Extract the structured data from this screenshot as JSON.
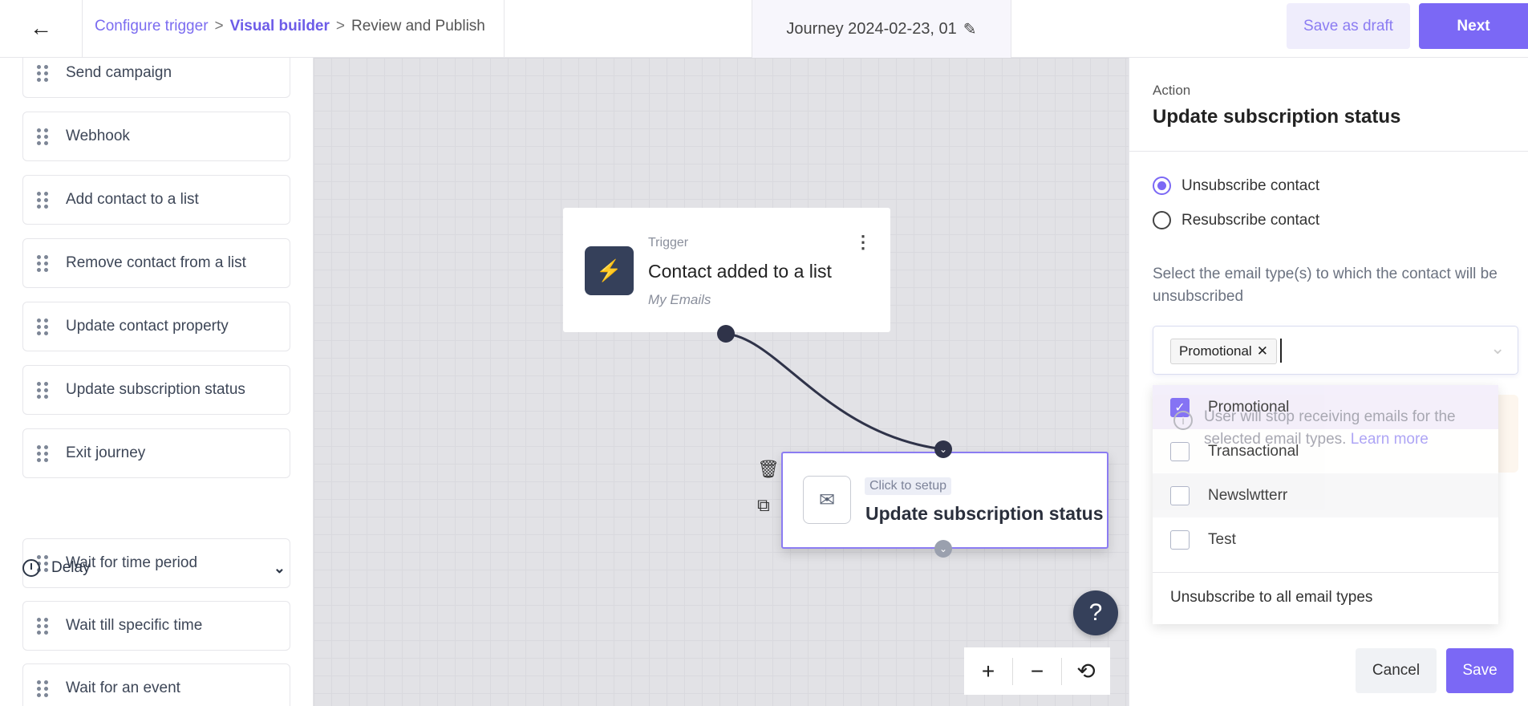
{
  "header": {
    "breadcrumbs": [
      "Configure trigger",
      "Visual builder",
      "Review and Publish"
    ],
    "breadcrumb_separator": ">",
    "journey_title": "Journey 2024-02-23, 01",
    "save_draft_label": "Save as draft",
    "next_label": "Next"
  },
  "sidebar": {
    "items": [
      "Send campaign",
      "Webhook",
      "Add contact to a list",
      "Remove contact from a list",
      "Update contact property",
      "Update subscription status",
      "Exit journey"
    ],
    "delay_section": "Delay",
    "delay_items": [
      "Wait for time period",
      "Wait till specific time",
      "Wait for an event"
    ]
  },
  "canvas": {
    "trigger": {
      "label": "Trigger",
      "title": "Contact added to a list",
      "subtitle": "My Emails"
    },
    "action": {
      "badge": "Click to setup",
      "title": "Update subscription status"
    },
    "help_label": "?",
    "zoom_in": "+",
    "zoom_out": "−",
    "reset": "⟲"
  },
  "panel": {
    "label": "Action",
    "title": "Update subscription status",
    "radios": [
      {
        "label": "Unsubscribe contact",
        "selected": true
      },
      {
        "label": "Resubscribe contact",
        "selected": false
      }
    ],
    "help_text": "Select the email type(s) to which the contact will be unsubscribed",
    "selected_chip": "Promotional",
    "warning_text": "User will stop receiving emails for the selected email types.",
    "learn_more": "Learn more",
    "options": [
      {
        "label": "Promotional",
        "checked": true
      },
      {
        "label": "Transactional",
        "checked": false
      },
      {
        "label": "Newslwtterr",
        "checked": false
      },
      {
        "label": "Test",
        "checked": false
      }
    ],
    "unsubscribe_all": "Unsubscribe to all email types",
    "cancel_label": "Cancel",
    "save_label": "Save"
  },
  "colors": {
    "accent": "#7b68f5",
    "dark_node": "#35405a",
    "canvas_bg": "#e2e2e6"
  }
}
